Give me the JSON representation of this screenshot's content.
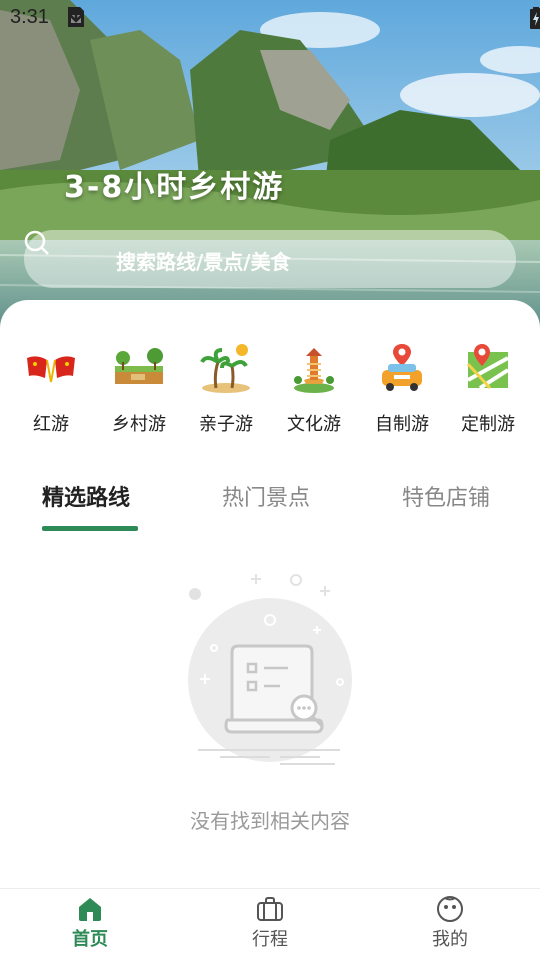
{
  "status_bar": {
    "time": "3:31",
    "left_icons": [
      "sim-card-icon",
      "download-icon"
    ],
    "right_icons": [
      "location-icon",
      "wifi-icon",
      "signal-icon",
      "battery-charging-icon"
    ]
  },
  "hero": {
    "title": "3-8小时乡村游",
    "search": {
      "placeholder": "搜索路线/景点/美食",
      "icon": "search-icon"
    }
  },
  "categories": [
    {
      "label": "红游",
      "icon": "red-flags-icon"
    },
    {
      "label": "乡村游",
      "icon": "village-icon"
    },
    {
      "label": "亲子游",
      "icon": "palm-island-icon"
    },
    {
      "label": "文化游",
      "icon": "pagoda-icon"
    },
    {
      "label": "自制游",
      "icon": "car-pin-icon"
    },
    {
      "label": "定制游",
      "icon": "map-pin-icon"
    }
  ],
  "tabs": [
    {
      "label": "精选路线",
      "active": true
    },
    {
      "label": "热门景点",
      "active": false
    },
    {
      "label": "特色店铺",
      "active": false
    }
  ],
  "empty_state": {
    "message": "没有找到相关内容",
    "icon": "empty-document-search-icon"
  },
  "bottom_nav": [
    {
      "label": "首页",
      "icon": "home-icon",
      "active": true
    },
    {
      "label": "行程",
      "icon": "briefcase-icon",
      "active": false
    },
    {
      "label": "我的",
      "icon": "profile-face-icon",
      "active": false
    }
  ],
  "colors": {
    "accent": "#2e8b57",
    "tab_inactive": "#888888",
    "empty_text": "#9a9a9a"
  }
}
